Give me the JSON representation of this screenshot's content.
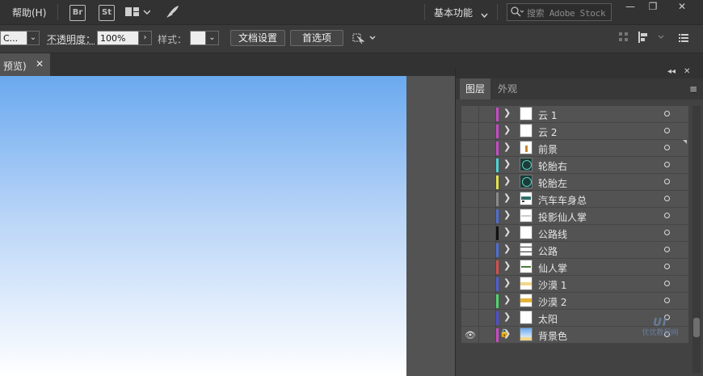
{
  "menubar": {
    "help": "帮助(H)",
    "bridge": "Br",
    "stock": "St",
    "workspace": "基本功能",
    "search_placeholder": "搜索 Adobe Stock",
    "min": "—",
    "restore": "❐",
    "close": "✕"
  },
  "control_bar": {
    "partial_value": "C...",
    "opacity_label": "不透明度：",
    "opacity_value": "100%",
    "style_label": "样式：",
    "doc_setup": "文档设置",
    "preferences": "首选项"
  },
  "document_tab": {
    "label": "预览)",
    "close": "✕"
  },
  "layers_panel": {
    "tab_layers": "图层",
    "tab_appearance": "外观",
    "layers": [
      {
        "name": "云 1",
        "color": "#c84bc7",
        "thumb": "blank"
      },
      {
        "name": "云 2",
        "color": "#c84bc7",
        "thumb": "blank"
      },
      {
        "name": "前景",
        "color": "#c84bc7",
        "thumb": "plant"
      },
      {
        "name": "轮胎右",
        "color": "#4fd5d5",
        "thumb": "tire"
      },
      {
        "name": "轮胎左",
        "color": "#e3e34f",
        "thumb": "tire"
      },
      {
        "name": "汽车车身总",
        "color": "#8a8a8a",
        "thumb": "car"
      },
      {
        "name": "投影仙人掌",
        "color": "#4f6fd5",
        "thumb": "shadow"
      },
      {
        "name": "公路线",
        "color": "#111111",
        "thumb": "blank"
      },
      {
        "name": "公路",
        "color": "#4f6fd5",
        "thumb": "road"
      },
      {
        "name": "仙人掌",
        "color": "#d54f4f",
        "thumb": "cactus"
      },
      {
        "name": "沙漠 1",
        "color": "#4f5fd5",
        "thumb": "sand"
      },
      {
        "name": "沙漠 2",
        "color": "#4fd56f",
        "thumb": "sand2"
      },
      {
        "name": "太阳",
        "color": "#4f4fd5",
        "thumb": "blank"
      },
      {
        "name": "背景色",
        "color": "#c84bc7",
        "thumb": "sky"
      }
    ]
  },
  "watermark": {
    "line1": "UI",
    "line2": "优优教程网"
  }
}
